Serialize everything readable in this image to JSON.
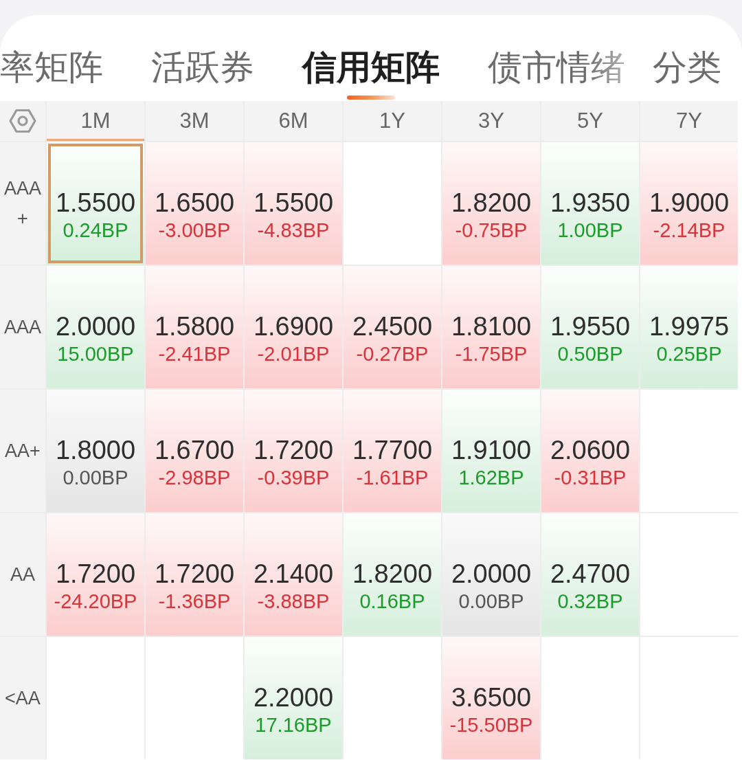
{
  "tabs": [
    {
      "label": "率矩阵",
      "selected": false
    },
    {
      "label": "活跃券",
      "selected": false
    },
    {
      "label": "信用矩阵",
      "selected": true
    },
    {
      "label": "债市情绪",
      "selected": false
    }
  ],
  "pinned_tab": {
    "label": "分类"
  },
  "columns": [
    {
      "label": "1M",
      "selected": true
    },
    {
      "label": "3M",
      "selected": false
    },
    {
      "label": "6M",
      "selected": false
    },
    {
      "label": "1Y",
      "selected": false
    },
    {
      "label": "3Y",
      "selected": false
    },
    {
      "label": "5Y",
      "selected": false
    },
    {
      "label": "7Y",
      "selected": false
    }
  ],
  "rows": [
    {
      "label": "AAA+",
      "cells": [
        {
          "value": "1.5500",
          "change": "0.24BP",
          "kind": "up",
          "selected": true
        },
        {
          "value": "1.6500",
          "change": "-3.00BP",
          "kind": "down",
          "selected": false
        },
        {
          "value": "1.5500",
          "change": "-4.83BP",
          "kind": "down",
          "selected": false
        },
        null,
        {
          "value": "1.8200",
          "change": "-0.75BP",
          "kind": "down",
          "selected": false
        },
        {
          "value": "1.9350",
          "change": "1.00BP",
          "kind": "up",
          "selected": false
        },
        {
          "value": "1.9000",
          "change": "-2.14BP",
          "kind": "down",
          "selected": false
        }
      ]
    },
    {
      "label": "AAA",
      "cells": [
        {
          "value": "2.0000",
          "change": "15.00BP",
          "kind": "up",
          "selected": false
        },
        {
          "value": "1.5800",
          "change": "-2.41BP",
          "kind": "down",
          "selected": false
        },
        {
          "value": "1.6900",
          "change": "-2.01BP",
          "kind": "down",
          "selected": false
        },
        {
          "value": "2.4500",
          "change": "-0.27BP",
          "kind": "down",
          "selected": false
        },
        {
          "value": "1.8100",
          "change": "-1.75BP",
          "kind": "down",
          "selected": false
        },
        {
          "value": "1.9550",
          "change": "0.50BP",
          "kind": "up",
          "selected": false
        },
        {
          "value": "1.9975",
          "change": "0.25BP",
          "kind": "up",
          "selected": false
        }
      ]
    },
    {
      "label": "AA+",
      "cells": [
        {
          "value": "1.8000",
          "change": "0.00BP",
          "kind": "flat",
          "selected": false
        },
        {
          "value": "1.6700",
          "change": "-2.98BP",
          "kind": "down",
          "selected": false
        },
        {
          "value": "1.7200",
          "change": "-0.39BP",
          "kind": "down",
          "selected": false
        },
        {
          "value": "1.7700",
          "change": "-1.61BP",
          "kind": "down",
          "selected": false
        },
        {
          "value": "1.9100",
          "change": "1.62BP",
          "kind": "up",
          "selected": false
        },
        {
          "value": "2.0600",
          "change": "-0.31BP",
          "kind": "down",
          "selected": false
        },
        null
      ]
    },
    {
      "label": "AA",
      "cells": [
        {
          "value": "1.7200",
          "change": "-24.20BP",
          "kind": "down",
          "selected": false
        },
        {
          "value": "1.7200",
          "change": "-1.36BP",
          "kind": "down",
          "selected": false
        },
        {
          "value": "2.1400",
          "change": "-3.88BP",
          "kind": "down",
          "selected": false
        },
        {
          "value": "1.8200",
          "change": "0.16BP",
          "kind": "up",
          "selected": false
        },
        {
          "value": "2.0000",
          "change": "0.00BP",
          "kind": "flat",
          "selected": false
        },
        {
          "value": "2.4700",
          "change": "0.32BP",
          "kind": "up",
          "selected": false
        },
        null
      ]
    },
    {
      "label": "<AA",
      "cells": [
        null,
        null,
        {
          "value": "2.2000",
          "change": "17.16BP",
          "kind": "up",
          "selected": false
        },
        null,
        {
          "value": "3.6500",
          "change": "-15.50BP",
          "kind": "down",
          "selected": false
        },
        null,
        null
      ]
    }
  ]
}
